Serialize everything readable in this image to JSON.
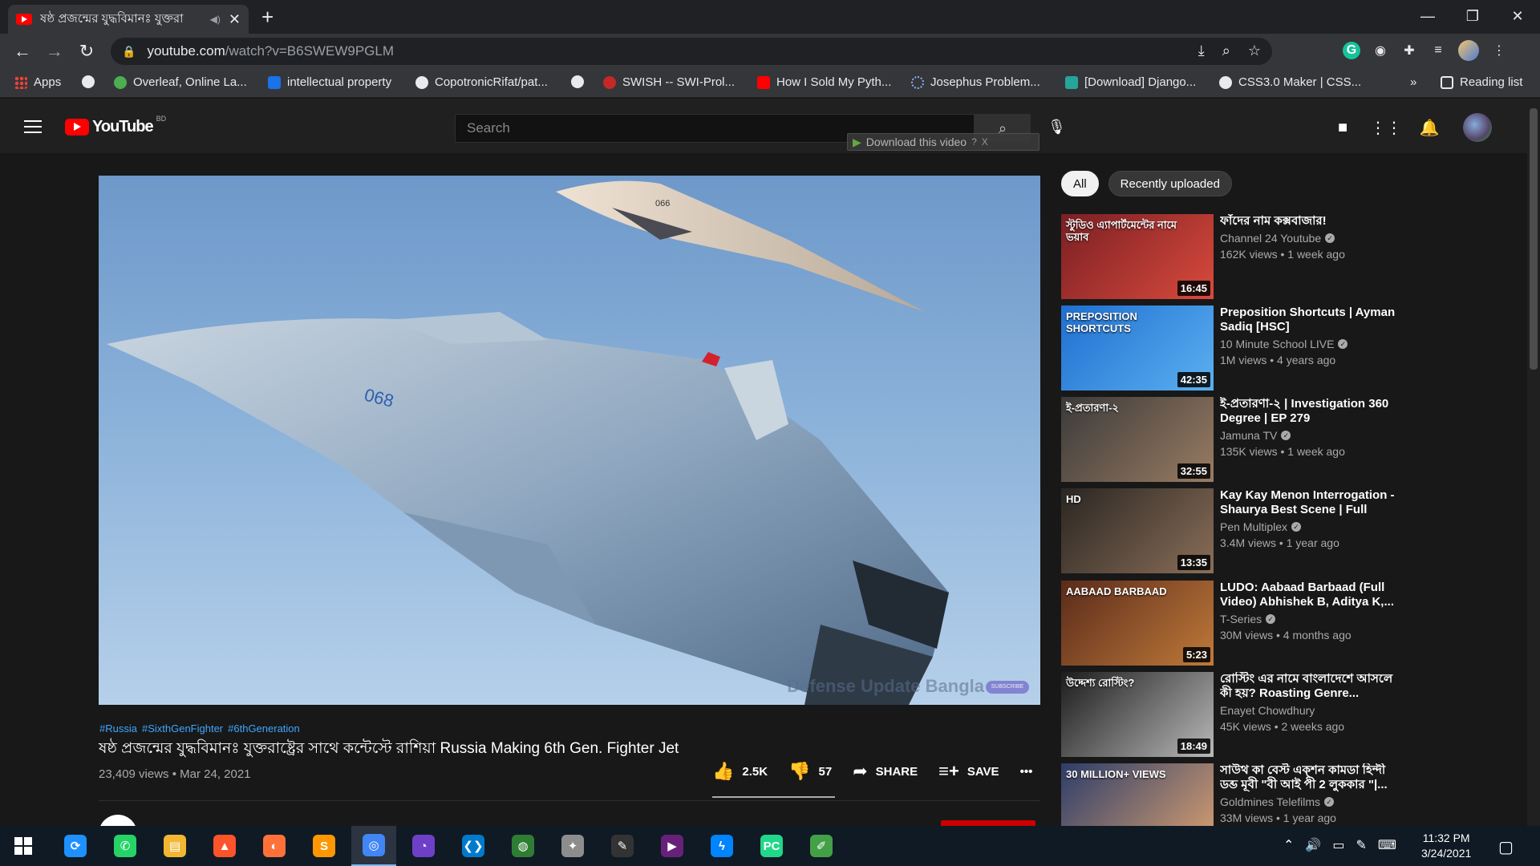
{
  "browser": {
    "tab_title": "ষষ্ঠ প্রজন্মের যুদ্ধবিমানঃ যুক্তরা",
    "new_tab_label": "+",
    "window_controls": [
      "—",
      "❐",
      "✕"
    ],
    "url_host": "youtube.com",
    "url_path": "/watch?v=B6SWEW9PGLM",
    "bookmarks": [
      {
        "label": "Apps",
        "icon": "apps-icon"
      },
      {
        "label": "",
        "icon": "globe-icon"
      },
      {
        "label": "Overleaf, Online La...",
        "icon": "overleaf-icon"
      },
      {
        "label": "intellectual property",
        "icon": "bookmark-icon"
      },
      {
        "label": "CopotronicRifat/pat...",
        "icon": "github-icon"
      },
      {
        "label": "",
        "icon": "globe-icon"
      },
      {
        "label": "SWISH -- SWI-Prol...",
        "icon": "swish-icon"
      },
      {
        "label": "How I Sold My Pyth...",
        "icon": "youtube-icon"
      },
      {
        "label": "Josephus Problem...",
        "icon": "loading-icon"
      },
      {
        "label": "[Download] Django...",
        "icon": "django-icon"
      },
      {
        "label": "CSS3.0 Maker | CSS...",
        "icon": "globe-icon"
      }
    ],
    "bookmarks_overflow": "»",
    "reading_list": "Reading list"
  },
  "youtube": {
    "logo_word": "YouTube",
    "region": "BD",
    "search_placeholder": "Search",
    "download_overlay": "Download this video",
    "download_help": "?",
    "download_close": "X",
    "video": {
      "hashtags": [
        "#Russia",
        "#SixthGenFighter",
        "#6thGeneration"
      ],
      "title": "ষষ্ঠ প্রজন্মের যুদ্ধবিমানঃ যুক্তরাষ্ট্রের সাথে কন্টেস্টে রাশিয়া Russia Making 6th Gen. Fighter Jet",
      "views_date": "23,409 views • Mar 24, 2021",
      "likes": "2.5K",
      "dislikes": "57",
      "share_label": "SHARE",
      "save_label": "SAVE",
      "more": "•••",
      "watermark": "Defense Update Bangla",
      "jet_nose_number": "066",
      "jet_main_number": "068",
      "subscribe_badge": "SUBSCRIBE"
    },
    "chips": [
      "All",
      "Recently uploaded"
    ],
    "recommendations": [
      {
        "title": "ফাঁদের নাম কক্সবাজার!",
        "channel": "Channel 24 Youtube",
        "meta": "162K views • 1 week ago",
        "duration": "16:45",
        "verified": true,
        "thumb_text": "স্টুডিও এ্যাপার্টমেন্টের নামে ভয়াব",
        "colors": [
          "#7a1f24",
          "#d94a3c"
        ]
      },
      {
        "title": "Preposition Shortcuts | Ayman Sadiq [HSC]",
        "channel": "10 Minute School LIVE",
        "meta": "1M views • 4 years ago",
        "duration": "42:35",
        "verified": true,
        "thumb_text": "PREPOSITION SHORTCUTS",
        "colors": [
          "#1f6fd1",
          "#5bb0f0"
        ]
      },
      {
        "title": "ই-প্রতারণা-২ | Investigation 360 Degree | EP 279",
        "channel": "Jamuna TV",
        "meta": "135K views • 1 week ago",
        "duration": "32:55",
        "verified": true,
        "thumb_text": "ই-প্রতারণা-২",
        "colors": [
          "#3a3a3a",
          "#9a7c62"
        ]
      },
      {
        "title": "Kay Kay Menon Interrogation - Shaurya Best Scene | Full Hind...",
        "channel": "Pen Multiplex",
        "meta": "3.4M views • 1 year ago",
        "duration": "13:35",
        "verified": true,
        "thumb_text": "HD",
        "colors": [
          "#2a2622",
          "#8a6e58"
        ]
      },
      {
        "title": "LUDO: Aabaad Barbaad (Full Video) Abhishek B, Aditya K,...",
        "channel": "T-Series",
        "meta": "30M views • 4 months ago",
        "duration": "5:23",
        "verified": true,
        "thumb_text": "AABAAD BARBAAD",
        "colors": [
          "#5a2b1a",
          "#c07a3a"
        ]
      },
      {
        "title": "রোস্টিং এর নামে বাংলাদেশে আসলে কী হয়? Roasting Genre...",
        "channel": "Enayet Chowdhury",
        "meta": "45K views • 2 weeks ago",
        "duration": "18:49",
        "verified": false,
        "thumb_text": "উদ্দেশ্য রোস্টিং?",
        "colors": [
          "#1c1c1c",
          "#b9b9b9"
        ]
      },
      {
        "title": "সাউথ কা বেস্ট এক্শন কামডা হিন্দী ডব্ড মূবী \"বী আই পী 2 লুককার \"|...",
        "channel": "Goldmines Telefilms",
        "meta": "33M views • 1 year ago",
        "duration": "",
        "verified": true,
        "thumb_text": "30 MILLION+ VIEWS",
        "colors": [
          "#2d3d6a",
          "#d8a070"
        ]
      }
    ]
  },
  "taskbar": {
    "apps": [
      "search",
      "whatsapp",
      "explorer",
      "brave",
      "firefox",
      "sublime",
      "chrome",
      "github-desktop",
      "vscode",
      "maps",
      "parrot",
      "inkscape",
      "visual-studio",
      "messenger",
      "pycharm",
      "notepad"
    ],
    "time": "11:32 PM",
    "date": "3/24/2021"
  }
}
